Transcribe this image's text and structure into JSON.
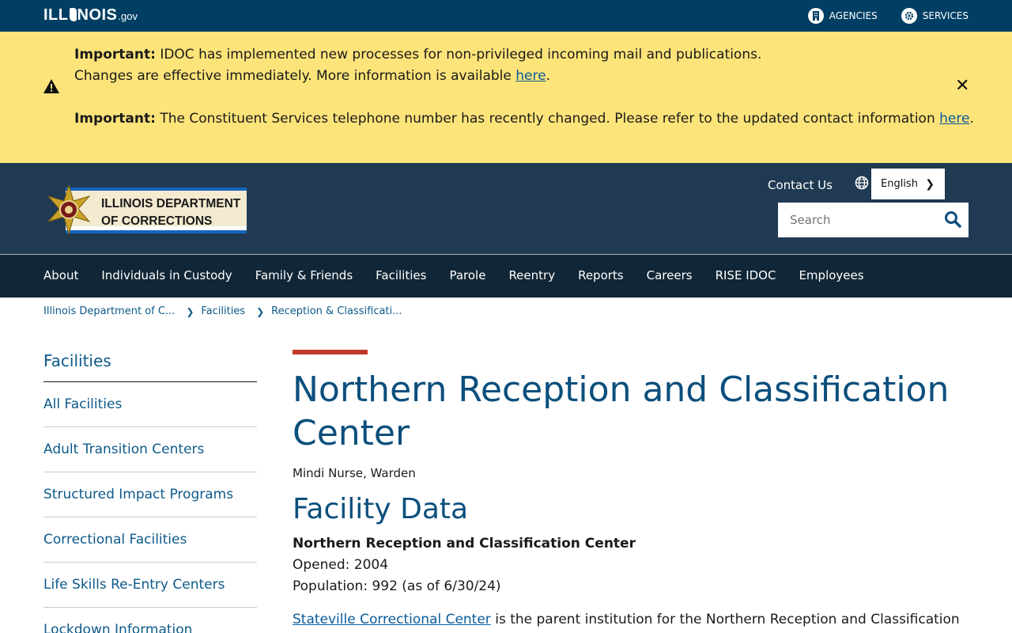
{
  "gov_bar": {
    "logo_text": "ILL",
    "logo_text_b": "NOIS",
    "logo_suffix": ".gov",
    "links": [
      {
        "label": "AGENCIES",
        "icon": "building-icon"
      },
      {
        "label": "SERVICES",
        "icon": "gear-icon"
      }
    ]
  },
  "alert": {
    "important_label": "Important:",
    "msg1_line1": "IDOC has implemented new processes for non-privileged incoming mail and publications.",
    "msg1_line2": "Changes are effective immediately. More information is available",
    "msg1_link": "here",
    "msg2_text": "The Constituent Services telephone number has recently changed. Please refer to the updated contact information",
    "msg2_link": "here",
    "period": "."
  },
  "header": {
    "agency_line1": "ILLINOIS DEPARTMENT",
    "agency_line2": "OF CORRECTIONS",
    "contact": "Contact Us",
    "language": "English",
    "search_placeholder": "Search"
  },
  "nav": {
    "items": [
      "About",
      "Individuals in Custody",
      "Family & Friends",
      "Facilities",
      "Parole",
      "Reentry",
      "Reports",
      "Careers",
      "RISE IDOC",
      "Employees"
    ]
  },
  "breadcrumb": [
    "Illinois Department of C...",
    "Facilities",
    "Reception & Classificati..."
  ],
  "sidebar": {
    "title": "Facilities",
    "items": [
      "All Facilities",
      "Adult Transition Centers",
      "Structured Impact Programs",
      "Correctional Facilities",
      "Life Skills Re-Entry Centers",
      "Lockdown Information"
    ]
  },
  "main": {
    "title": "Northern Reception and Classification Center",
    "warden": "Mindi Nurse, Warden",
    "section_title": "Facility Data",
    "facility_name": "Northern Reception and Classification Center",
    "opened": "Opened: 2004",
    "population": "Population: 992 (as of 6/30/24)",
    "parent_link": "Stateville Correctional Center",
    "parent_text": "is the parent institution for the Northern Reception and Classification"
  },
  "colors": {
    "gov_bar": "#003f63",
    "alert_bg": "#fde47a",
    "header_bg": "#1f3a52",
    "nav_bg": "#112636",
    "link": "#0d5a8a",
    "accent_bar": "#c0392b"
  }
}
